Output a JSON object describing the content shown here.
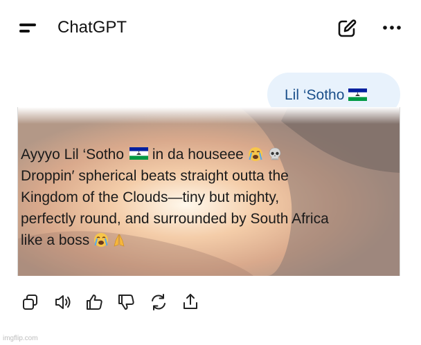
{
  "header": {
    "title": "ChatGPT",
    "menu_icon": "menu-icon",
    "edit_icon": "new-chat-icon",
    "more_icon": "more-options-icon"
  },
  "user_message": {
    "text": "Lil ‘Sotho",
    "flag": "Lesotho flag"
  },
  "response_image": {
    "lines": [
      "Ayyyo Lil ‘Sotho",
      "in da houseee",
      "Droppin′ spherical beats straight outta the",
      "Kingdom of the Clouds—tiny but mighty,",
      "perfectly round, and surrounded by South Africa",
      "like a boss"
    ],
    "emojis": [
      "lesotho-flag",
      "loudly-crying-face",
      "skull",
      "loudly-crying-face",
      "folded-hands"
    ]
  },
  "action_bar": {
    "icons": [
      "copy-icon",
      "read-aloud-icon",
      "thumbs-up-icon",
      "thumbs-down-icon",
      "regenerate-icon",
      "share-icon"
    ]
  },
  "watermark": "imgflip.com",
  "colors": {
    "user_bubble_bg": "#e8f2fc",
    "user_text": "#1a4f8a",
    "flag_blue": "#00209f",
    "flag_green": "#009a44"
  }
}
